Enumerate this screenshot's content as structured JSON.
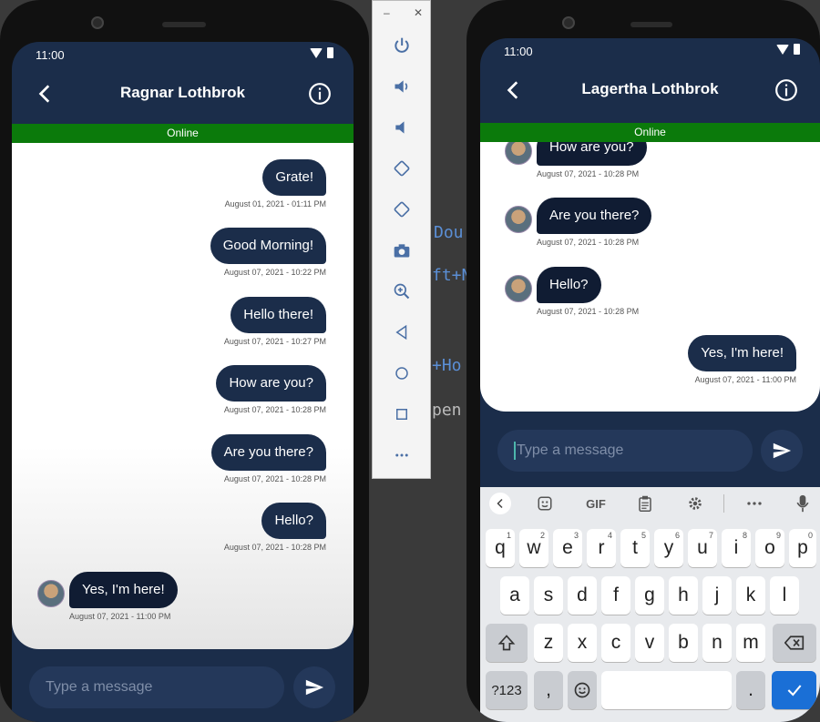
{
  "left_phone": {
    "status_time": "11:00",
    "title": "Ragnar Lothbrok",
    "status": "Online",
    "messages": [
      {
        "text": "Grate!",
        "time": "August 01, 2021 - 01:11 PM",
        "side": "out"
      },
      {
        "text": "Good Morning!",
        "time": "August 07, 2021 - 10:22 PM",
        "side": "out"
      },
      {
        "text": "Hello there!",
        "time": "August 07, 2021 - 10:27 PM",
        "side": "out"
      },
      {
        "text": "How are you?",
        "time": "August 07, 2021 - 10:28 PM",
        "side": "out"
      },
      {
        "text": "Are you there?",
        "time": "August 07, 2021 - 10:28 PM",
        "side": "out"
      },
      {
        "text": "Hello?",
        "time": "August 07, 2021 - 10:28 PM",
        "side": "out"
      },
      {
        "text": "Yes, I'm here!",
        "time": "August 07, 2021 - 11:00 PM",
        "side": "in"
      }
    ],
    "input_placeholder": "Type a message"
  },
  "right_phone": {
    "status_time": "11:00",
    "title": "Lagertha Lothbrok",
    "status": "Online",
    "messages": [
      {
        "text": "How are you?",
        "time": "August 07, 2021 - 10:28 PM",
        "side": "in"
      },
      {
        "text": "Are you there?",
        "time": "August 07, 2021 - 10:28 PM",
        "side": "in"
      },
      {
        "text": "Hello?",
        "time": "August 07, 2021 - 10:28 PM",
        "side": "in"
      },
      {
        "text": "Yes, I'm here!",
        "time": "August 07, 2021 - 11:00 PM",
        "side": "out"
      }
    ],
    "input_placeholder": "Type a message"
  },
  "background_text": [
    "Dou",
    "ft+N",
    "+Ho",
    "pen"
  ],
  "emulator_panel": {
    "buttons": [
      "power-icon",
      "volume-up-icon",
      "volume-down-icon",
      "rotate-left-icon",
      "rotate-right-icon",
      "camera-icon",
      "zoom-icon",
      "back-icon",
      "home-icon",
      "overview-icon",
      "more-icon"
    ]
  },
  "keyboard": {
    "toolbar_gif": "GIF",
    "row1": [
      {
        "k": "q",
        "n": "1"
      },
      {
        "k": "w",
        "n": "2"
      },
      {
        "k": "e",
        "n": "3"
      },
      {
        "k": "r",
        "n": "4"
      },
      {
        "k": "t",
        "n": "5"
      },
      {
        "k": "y",
        "n": "6"
      },
      {
        "k": "u",
        "n": "7"
      },
      {
        "k": "i",
        "n": "8"
      },
      {
        "k": "o",
        "n": "9"
      },
      {
        "k": "p",
        "n": "0"
      }
    ],
    "row2": [
      "a",
      "s",
      "d",
      "f",
      "g",
      "h",
      "j",
      "k",
      "l"
    ],
    "row3": [
      "z",
      "x",
      "c",
      "v",
      "b",
      "n",
      "m"
    ],
    "symbols_label": "?123",
    "comma": ",",
    "period": "."
  },
  "colors": {
    "header": "#1b2d4a",
    "online": "#0b7a0b",
    "bubble": "#1b2d4a",
    "keyboard": "#e8eaed",
    "accent_blue": "#1a6fd6"
  }
}
